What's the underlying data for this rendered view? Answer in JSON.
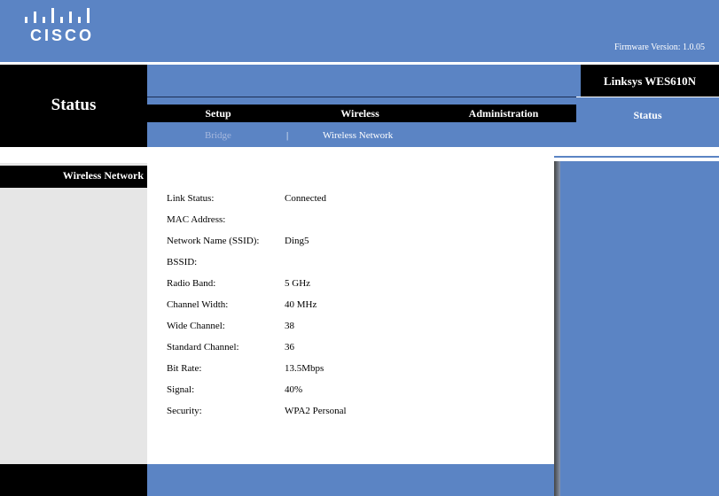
{
  "brand": {
    "logo_text": "CISCO",
    "product_name": "Linksys WES610N"
  },
  "header": {
    "firmware_label": "Firmware Version:",
    "firmware_version": "1.0.05"
  },
  "page_title": "Status",
  "nav": {
    "tabs": [
      {
        "label": "Setup"
      },
      {
        "label": "Wireless"
      },
      {
        "label": "Administration"
      },
      {
        "label": "Status",
        "active": true
      }
    ],
    "subtabs": [
      {
        "label": "Bridge"
      },
      {
        "label": "Wireless Network",
        "active": true
      }
    ],
    "subtab_separator": "|"
  },
  "section_title": "Wireless Network",
  "status_rows": [
    {
      "label": "Link Status:",
      "value": "Connected"
    },
    {
      "label": "MAC Address:",
      "value": ""
    },
    {
      "label": "Network Name (SSID):",
      "value": "Ding5"
    },
    {
      "label": "BSSID:",
      "value": ""
    },
    {
      "label": "Radio Band:",
      "value": "5 GHz"
    },
    {
      "label": "Channel Width:",
      "value": "40 MHz"
    },
    {
      "label": "Wide Channel:",
      "value": "38"
    },
    {
      "label": "Standard Channel:",
      "value": "36"
    },
    {
      "label": "Bit Rate:",
      "value": "13.5Mbps"
    },
    {
      "label": "Signal:",
      "value": "40%"
    },
    {
      "label": "Security:",
      "value": "WPA2 Personal"
    }
  ],
  "colors": {
    "brand_blue": "#5b84c4",
    "black": "#000000",
    "panel_gray": "#e6e6e6",
    "inactive_subtab": "#a6b8de"
  }
}
